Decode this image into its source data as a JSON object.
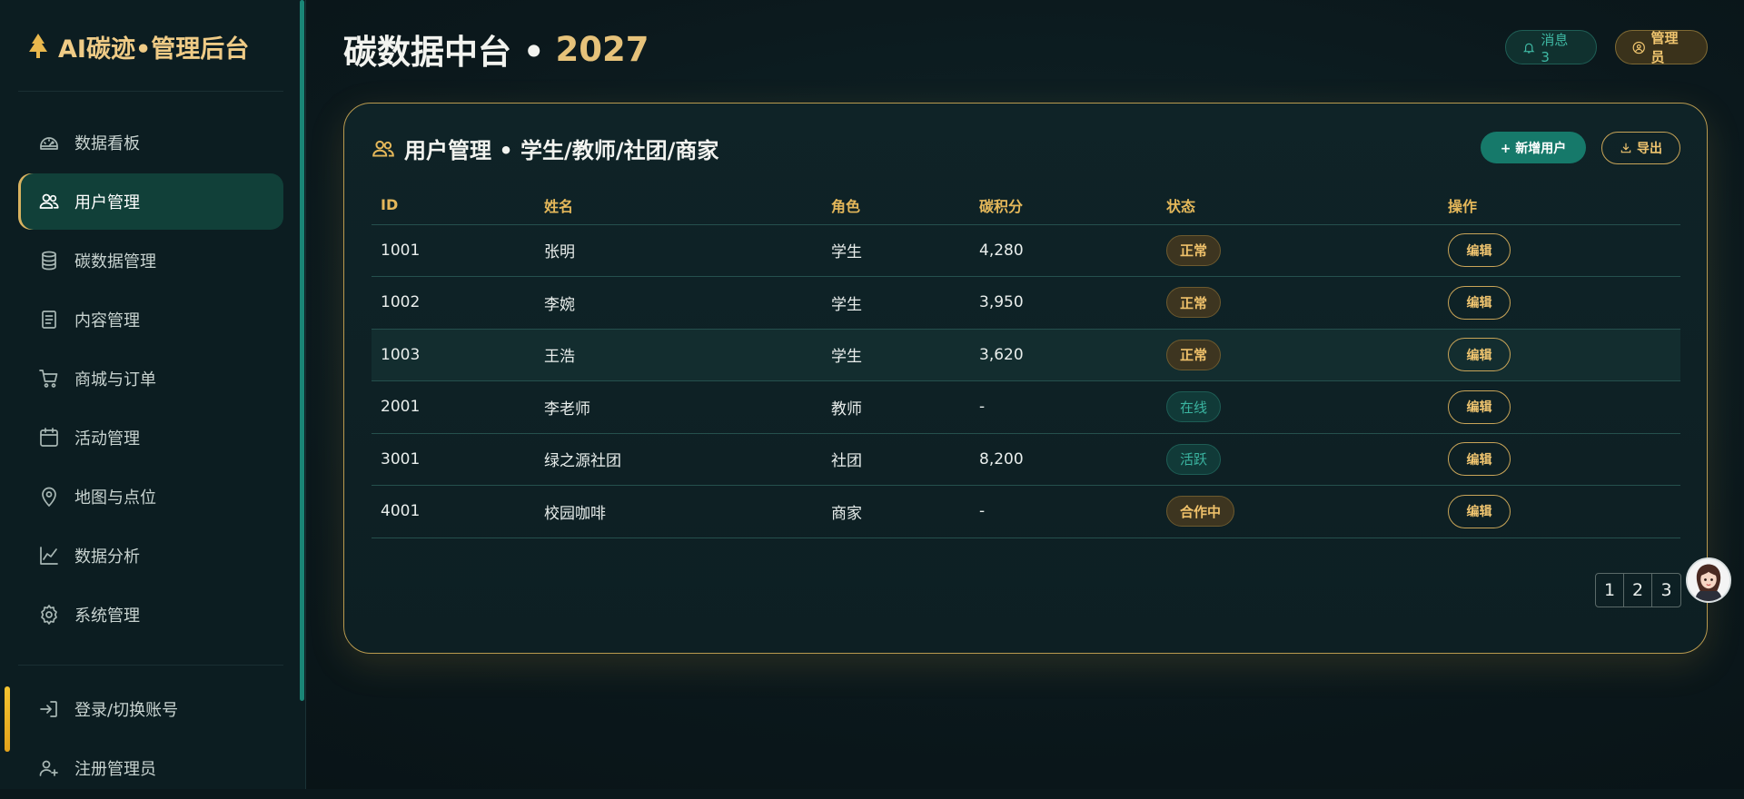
{
  "brand": {
    "title": "AI碳迹•管理后台"
  },
  "sidebar": {
    "items": [
      {
        "label": "数据看板",
        "icon": "dashboard-icon"
      },
      {
        "label": "用户管理",
        "icon": "users-icon",
        "active": true
      },
      {
        "label": "碳数据管理",
        "icon": "database-icon"
      },
      {
        "label": "内容管理",
        "icon": "document-icon"
      },
      {
        "label": "商城与订单",
        "icon": "cart-icon"
      },
      {
        "label": "活动管理",
        "icon": "calendar-icon"
      },
      {
        "label": "地图与点位",
        "icon": "map-pin-icon"
      },
      {
        "label": "数据分析",
        "icon": "line-chart-icon"
      },
      {
        "label": "系统管理",
        "icon": "gear-icon"
      }
    ],
    "bottom_items": [
      {
        "label": "登录/切换账号",
        "icon": "login-icon"
      },
      {
        "label": "注册管理员",
        "icon": "add-user-icon"
      }
    ]
  },
  "header": {
    "title": "碳数据中台 •",
    "year": "2027",
    "messages_label": "消息 3",
    "admin_label": "管理员"
  },
  "panel": {
    "title": "用户管理 • 学生/教师/社团/商家",
    "add_label": "+ 新增用户",
    "export_label": "导出",
    "columns": [
      "ID",
      "姓名",
      "角色",
      "碳积分",
      "状态",
      "操作"
    ],
    "rows": [
      {
        "id": "1001",
        "name": "张明",
        "role": "学生",
        "points": "4,280",
        "status": "正常",
        "status_style": "gold",
        "action": "编辑"
      },
      {
        "id": "1002",
        "name": "李婉",
        "role": "学生",
        "points": "3,950",
        "status": "正常",
        "status_style": "gold",
        "action": "编辑"
      },
      {
        "id": "1003",
        "name": "王浩",
        "role": "学生",
        "points": "3,620",
        "status": "正常",
        "status_style": "gold",
        "action": "编辑"
      },
      {
        "id": "2001",
        "name": "李老师",
        "role": "教师",
        "points": "-",
        "status": "在线",
        "status_style": "teal",
        "action": "编辑"
      },
      {
        "id": "3001",
        "name": "绿之源社团",
        "role": "社团",
        "points": "8,200",
        "status": "活跃",
        "status_style": "teal",
        "action": "编辑"
      },
      {
        "id": "4001",
        "name": "校园咖啡",
        "role": "商家",
        "points": "-",
        "status": "合作中",
        "status_style": "gold",
        "action": "编辑"
      }
    ],
    "pages": [
      "1",
      "2",
      "3"
    ]
  },
  "colors": {
    "accent_gold": "#e5b85a",
    "accent_teal": "#16796a",
    "background": "#0b181c"
  }
}
